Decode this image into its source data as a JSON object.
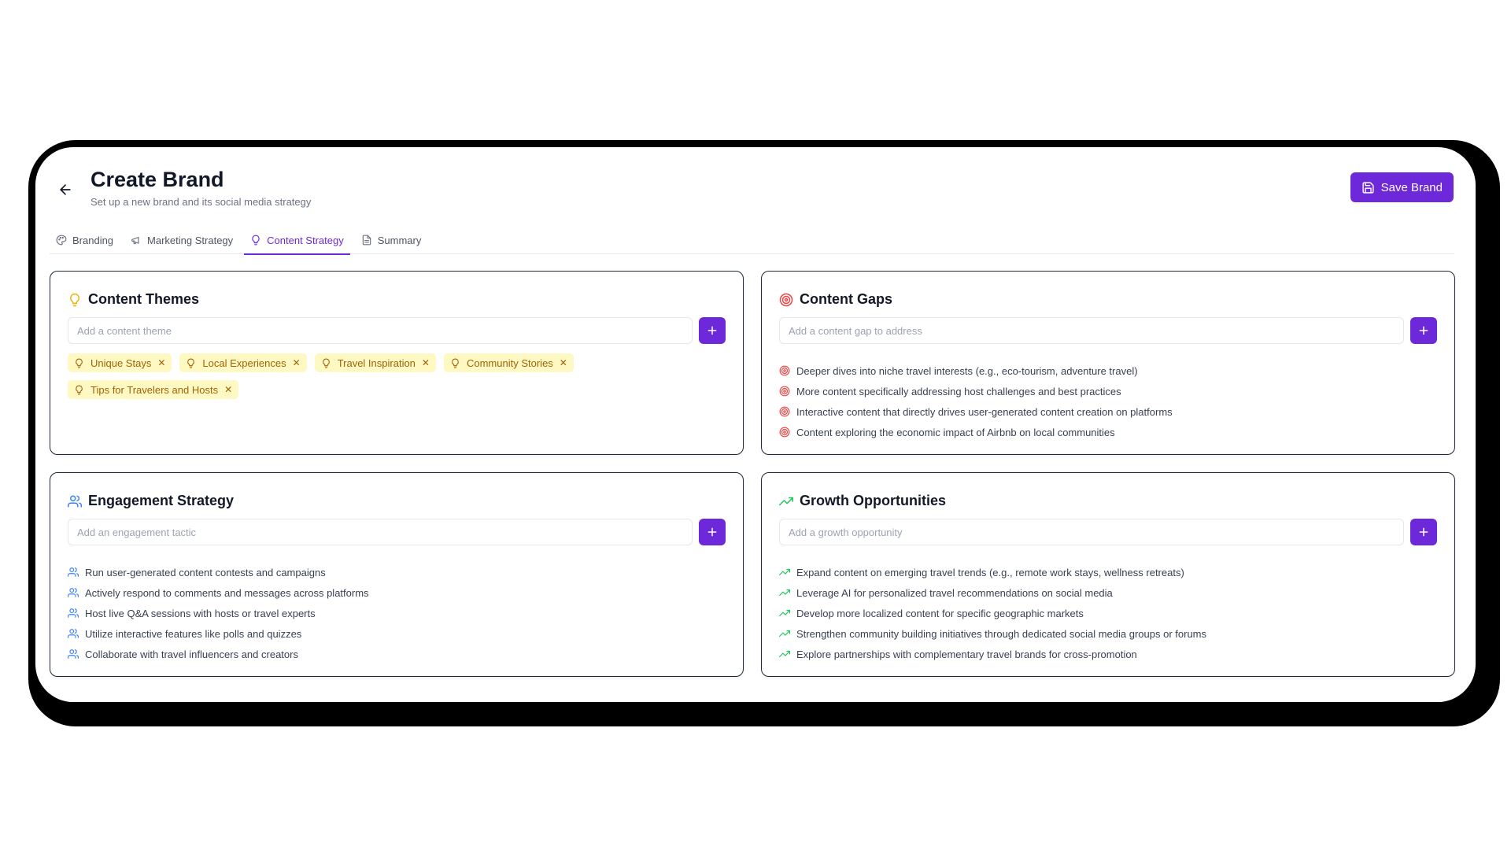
{
  "header": {
    "title": "Create Brand",
    "subtitle": "Set up a new brand and its social media strategy",
    "save_label": "Save Brand"
  },
  "tabs": [
    {
      "label": "Branding",
      "icon": "palette-icon"
    },
    {
      "label": "Marketing Strategy",
      "icon": "megaphone-icon"
    },
    {
      "label": "Content Strategy",
      "icon": "lightbulb-icon",
      "active": true
    },
    {
      "label": "Summary",
      "icon": "document-icon"
    }
  ],
  "colors": {
    "accent": "#6d28d9",
    "tag_bg": "#fef9c3",
    "tag_text": "#a16207",
    "gap_red": "#ef4444",
    "engage_blue": "#3b82f6",
    "growth_green": "#22c55e"
  },
  "themes": {
    "title": "Content Themes",
    "placeholder": "Add a content theme",
    "items": [
      "Unique Stays",
      "Local Experiences",
      "Travel Inspiration",
      "Community Stories",
      "Tips for Travelers and Hosts"
    ]
  },
  "gaps": {
    "title": "Content Gaps",
    "placeholder": "Add a content gap to address",
    "items": [
      "Deeper dives into niche travel interests (e.g., eco-tourism, adventure travel)",
      "More content specifically addressing host challenges and best practices",
      "Interactive content that directly drives user-generated content creation on platforms",
      "Content exploring the economic impact of Airbnb on local communities"
    ]
  },
  "engagement": {
    "title": "Engagement Strategy",
    "placeholder": "Add an engagement tactic",
    "items": [
      "Run user-generated content contests and campaigns",
      "Actively respond to comments and messages across platforms",
      "Host live Q&A sessions with hosts or travel experts",
      "Utilize interactive features like polls and quizzes",
      "Collaborate with travel influencers and creators"
    ]
  },
  "growth": {
    "title": "Growth Opportunities",
    "placeholder": "Add a growth opportunity",
    "items": [
      "Expand content on emerging travel trends (e.g., remote work stays, wellness retreats)",
      "Leverage AI for personalized travel recommendations on social media",
      "Develop more localized content for specific geographic markets",
      "Strengthen community building initiatives through dedicated social media groups or forums",
      "Explore partnerships with complementary travel brands for cross-promotion"
    ]
  }
}
